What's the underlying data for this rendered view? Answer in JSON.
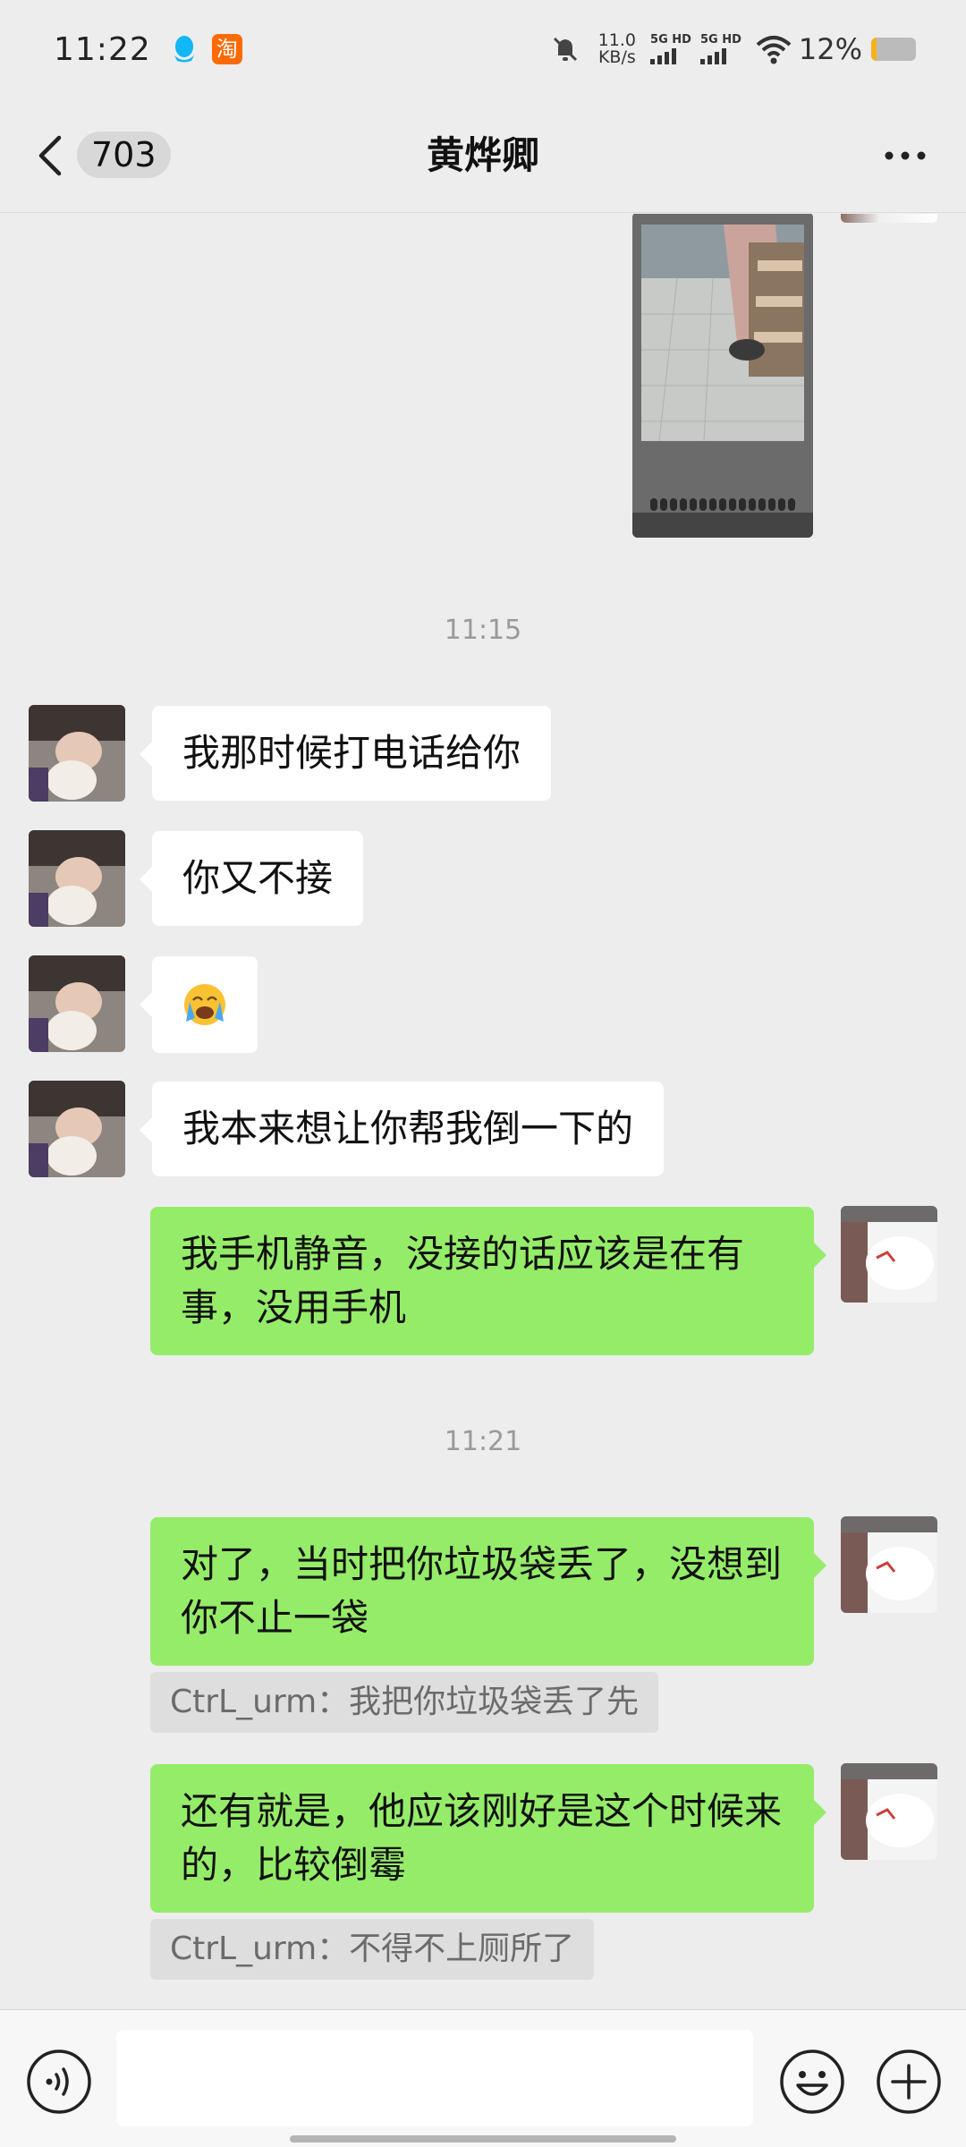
{
  "status_bar": {
    "time": "11:22",
    "taobao_glyph": "淘",
    "net_speed_value": "11.0",
    "net_speed_unit": "KB/s",
    "sim1_label": "5G HD",
    "sim2_label": "5G HD",
    "battery_percent": "12%",
    "battery_level": 0.12,
    "battery_color": "#f5b21a",
    "icons": [
      "qq-icon",
      "taobao-icon",
      "mute-icon",
      "signal-icon",
      "wifi-icon",
      "battery-icon"
    ]
  },
  "nav": {
    "unread_count": "703",
    "title": "黄烨卿",
    "icons": [
      "back-arrow-icon",
      "more-icon"
    ]
  },
  "messages": {
    "time_1": "11:15",
    "msg_1": "我那时候打电话给你",
    "msg_2": "你又不接",
    "msg_3": "😭",
    "msg_4": "我本来想让你帮我倒一下的",
    "msg_5": "我手机静音，没接的话应该是在有事，没用手机",
    "time_2": "11:21",
    "msg_6": "对了，当时把你垃圾袋丢了，没想到你不止一袋",
    "quote_1": "CtrL_urm：我把你垃圾袋丢了先",
    "msg_7": "还有就是，他应该刚好是这个时候来的，比较倒霉",
    "quote_2": "CtrL_urm：不得不上厕所了"
  },
  "input": {
    "placeholder": "",
    "icons": [
      "voice-icon",
      "emoji-icon",
      "plus-icon"
    ]
  },
  "colors": {
    "background": "#ededed",
    "sent_bubble": "#95ec69",
    "received_bubble": "#ffffff",
    "quote_background": "#dedede"
  }
}
